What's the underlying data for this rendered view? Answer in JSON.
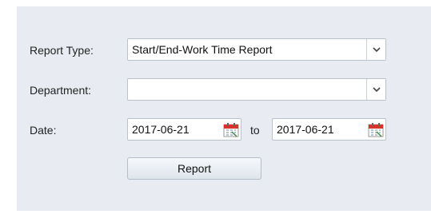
{
  "form": {
    "report_type": {
      "label": "Report Type:",
      "value": "Start/End-Work Time Report"
    },
    "department": {
      "label": "Department:",
      "value": ""
    },
    "date": {
      "label": "Date:",
      "from": "2017-06-21",
      "to_label": "to",
      "to": "2017-06-21"
    },
    "report_button": "Report"
  },
  "icons": {
    "dropdown_arrow": "chevron-down-icon",
    "calendar": "calendar-icon"
  },
  "colors": {
    "panel_bg": "#e8ecf2",
    "field_border": "#b9c2cd",
    "calendar_accent": "#d9342b"
  }
}
